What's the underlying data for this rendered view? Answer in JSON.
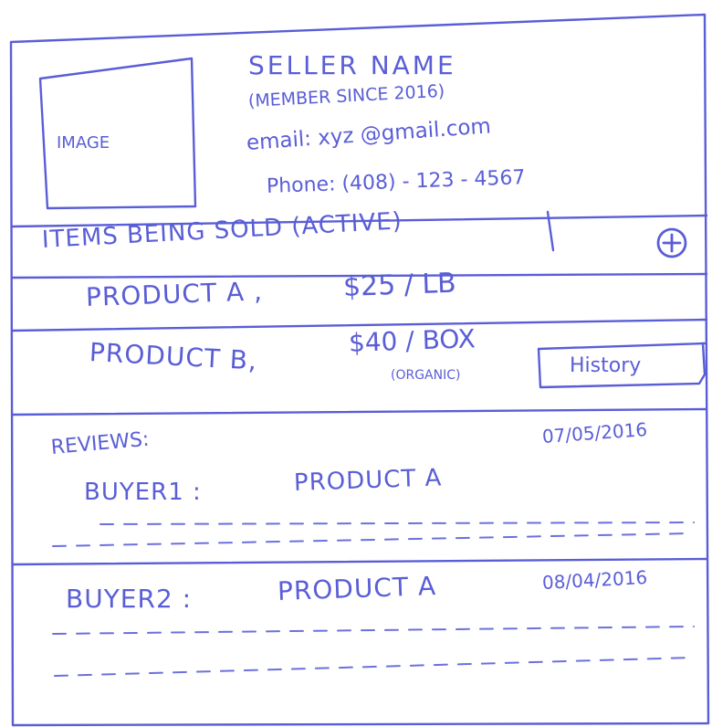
{
  "profile": {
    "image_label": "IMAGE",
    "seller_name": "SELLER NAME",
    "member_since": "(MEMBER SINCE 2016)",
    "email": "email: xyz @gmail.com",
    "phone": "Phone: (408) - 123 - 4567"
  },
  "items": {
    "heading": "ITEMS BEING SOLD (ACTIVE)",
    "add_icon": "plus-circle-icon",
    "list": [
      {
        "name": "PRODUCT A ,",
        "price": "$25 / LB"
      },
      {
        "name": "PRODUCT B,",
        "price": "$40 / BOX",
        "note": "(ORGANIC)",
        "history_label": "History"
      }
    ]
  },
  "reviews": {
    "heading": "REVIEWS:",
    "list": [
      {
        "buyer": "BUYER1 :",
        "product": "PRODUCT A",
        "date": "07/05/2016"
      },
      {
        "buyer": "BUYER2 :",
        "product": "PRODUCT A",
        "date": "08/04/2016"
      }
    ]
  },
  "colors": {
    "ink": "#5a5ed6"
  }
}
